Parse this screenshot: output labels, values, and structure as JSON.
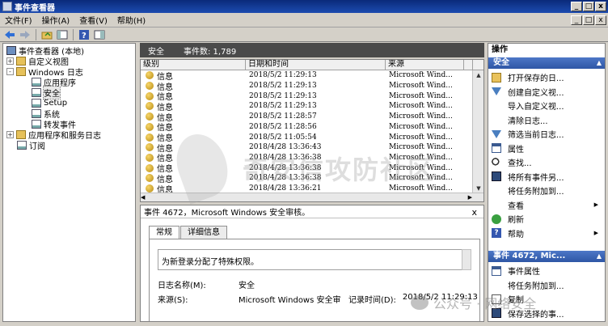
{
  "window": {
    "title": "事件查看器",
    "min": "_",
    "max": "□",
    "close": "x"
  },
  "menubar": {
    "items": [
      "文件(F)",
      "操作(A)",
      "查看(V)",
      "帮助(H)"
    ]
  },
  "tree": {
    "items": [
      {
        "label": "事件查看器 (本地)",
        "level": 0,
        "expander": "",
        "icon": "computer"
      },
      {
        "label": "自定义视图",
        "level": 1,
        "expander": "+",
        "icon": "folder"
      },
      {
        "label": "Windows 日志",
        "level": 1,
        "expander": "-",
        "icon": "folder"
      },
      {
        "label": "应用程序",
        "level": 2,
        "expander": "",
        "icon": "log"
      },
      {
        "label": "安全",
        "level": 2,
        "expander": "",
        "icon": "log",
        "selected": true
      },
      {
        "label": "Setup",
        "level": 2,
        "expander": "",
        "icon": "log"
      },
      {
        "label": "系统",
        "level": 2,
        "expander": "",
        "icon": "log"
      },
      {
        "label": "转发事件",
        "level": 2,
        "expander": "",
        "icon": "log"
      },
      {
        "label": "应用程序和服务日志",
        "level": 1,
        "expander": "+",
        "icon": "folder"
      },
      {
        "label": "订阅",
        "level": 1,
        "expander": "",
        "icon": "log"
      }
    ]
  },
  "center": {
    "log_name": "安全",
    "event_count": "事件数: 1,789",
    "columns": [
      "级别",
      "日期和时间",
      "来源"
    ],
    "rows": [
      {
        "level": "信息",
        "datetime": "2018/5/2 11:29:13",
        "source": "Microsoft Wind..."
      },
      {
        "level": "信息",
        "datetime": "2018/5/2 11:29:13",
        "source": "Microsoft Wind..."
      },
      {
        "level": "信息",
        "datetime": "2018/5/2 11:29:13",
        "source": "Microsoft Wind..."
      },
      {
        "level": "信息",
        "datetime": "2018/5/2 11:29:13",
        "source": "Microsoft Wind..."
      },
      {
        "level": "信息",
        "datetime": "2018/5/2 11:28:57",
        "source": "Microsoft Wind..."
      },
      {
        "level": "信息",
        "datetime": "2018/5/2 11:28:56",
        "source": "Microsoft Wind..."
      },
      {
        "level": "信息",
        "datetime": "2018/5/2 11:05:54",
        "source": "Microsoft Wind..."
      },
      {
        "level": "信息",
        "datetime": "2018/4/28 13:36:43",
        "source": "Microsoft Wind..."
      },
      {
        "level": "信息",
        "datetime": "2018/4/28 13:36:38",
        "source": "Microsoft Wind..."
      },
      {
        "level": "信息",
        "datetime": "2018/4/28 13:36:38",
        "source": "Microsoft Wind..."
      },
      {
        "level": "信息",
        "datetime": "2018/4/28 13:36:38",
        "source": "Microsoft Wind..."
      },
      {
        "level": "信息",
        "datetime": "2018/4/28 13:36:21",
        "source": "Microsoft Wind..."
      }
    ]
  },
  "detail": {
    "title": "事件 4672，Microsoft Windows 安全审核。",
    "close": "x",
    "tabs": [
      "常规",
      "详细信息"
    ],
    "message": "为新登录分配了特殊权限。",
    "log_name_label": "日志名称(M):",
    "log_name_value": "安全",
    "source_label": "来源(S):",
    "source_value": "Microsoft Windows 安全审",
    "logged_label": "记录时间(D):",
    "logged_value": "2018/5/2 11:29:13"
  },
  "actions": {
    "title": "操作",
    "section1_header": "安全",
    "section1_items": [
      {
        "label": "打开保存的日...",
        "icon": "open"
      },
      {
        "label": "创建自定义视...",
        "icon": "filter"
      },
      {
        "label": "导入自定义视...",
        "icon": "blank"
      },
      {
        "label": "清除日志...",
        "icon": "blank"
      },
      {
        "label": "筛选当前日志...",
        "icon": "filter"
      },
      {
        "label": "属性",
        "icon": "prop"
      },
      {
        "label": "查找...",
        "icon": "find"
      },
      {
        "label": "将所有事件另...",
        "icon": "save"
      },
      {
        "label": "将任务附加到...",
        "icon": "blank"
      },
      {
        "label": "查看",
        "icon": "blank",
        "submenu": true
      },
      {
        "label": "刷新",
        "icon": "refresh"
      },
      {
        "label": "帮助",
        "icon": "help",
        "submenu": true
      }
    ],
    "section2_header": "事件 4672, Mic...",
    "section2_items": [
      {
        "label": "事件属性",
        "icon": "prop"
      },
      {
        "label": "将任务附加到...",
        "icon": "blank"
      },
      {
        "label": "复制",
        "icon": "copy"
      },
      {
        "label": "保存选择的事...",
        "icon": "save"
      }
    ]
  },
  "watermarks": {
    "center": "奇安信攻防社区",
    "footer": "公众号 · 网络安全"
  }
}
